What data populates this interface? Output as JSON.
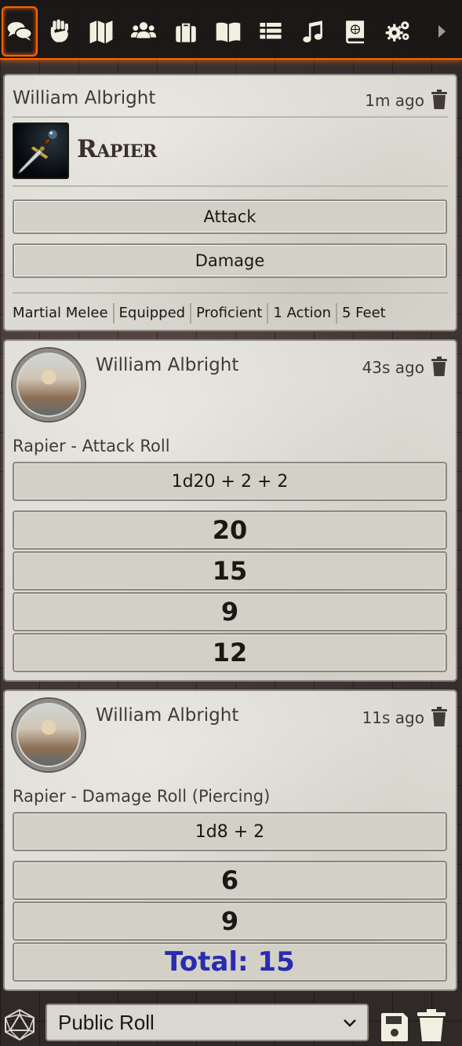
{
  "tabs": [
    {
      "icon": "chat-bubbles-icon",
      "active": true
    },
    {
      "icon": "fist-combat-icon"
    },
    {
      "icon": "map-icon"
    },
    {
      "icon": "users-icon"
    },
    {
      "icon": "suitcase-items-icon"
    },
    {
      "icon": "open-book-journal-icon"
    },
    {
      "icon": "list-tables-icon"
    },
    {
      "icon": "music-note-icon"
    },
    {
      "icon": "compendium-book-icon"
    },
    {
      "icon": "cogs-settings-icon"
    },
    {
      "icon": "caret-right-icon"
    }
  ],
  "messages": [
    {
      "sender": "William Albright",
      "time": "1m ago",
      "item_name": "Rapier",
      "buttons": [
        "Attack",
        "Damage"
      ],
      "properties": [
        "Martial Melee",
        "Equipped",
        "Proficient",
        "1 Action",
        "5 Feet"
      ]
    },
    {
      "sender": "William Albright",
      "time": "43s ago",
      "flavor": "Rapier - Attack Roll",
      "formula": "1d20 + 2 + 2",
      "results": [
        "20",
        "15",
        "9",
        "12"
      ]
    },
    {
      "sender": "William Albright",
      "time": "11s ago",
      "flavor": "Rapier - Damage Roll (Piercing)",
      "formula": "1d8 + 2",
      "results": [
        "6",
        "9"
      ],
      "total": "Total: 15"
    }
  ],
  "controls": {
    "roll_mode": "Public Roll"
  },
  "colors": {
    "accent": "#ff6400",
    "total_text": "#2b2bb0",
    "card_bg": "#dcdad2"
  }
}
